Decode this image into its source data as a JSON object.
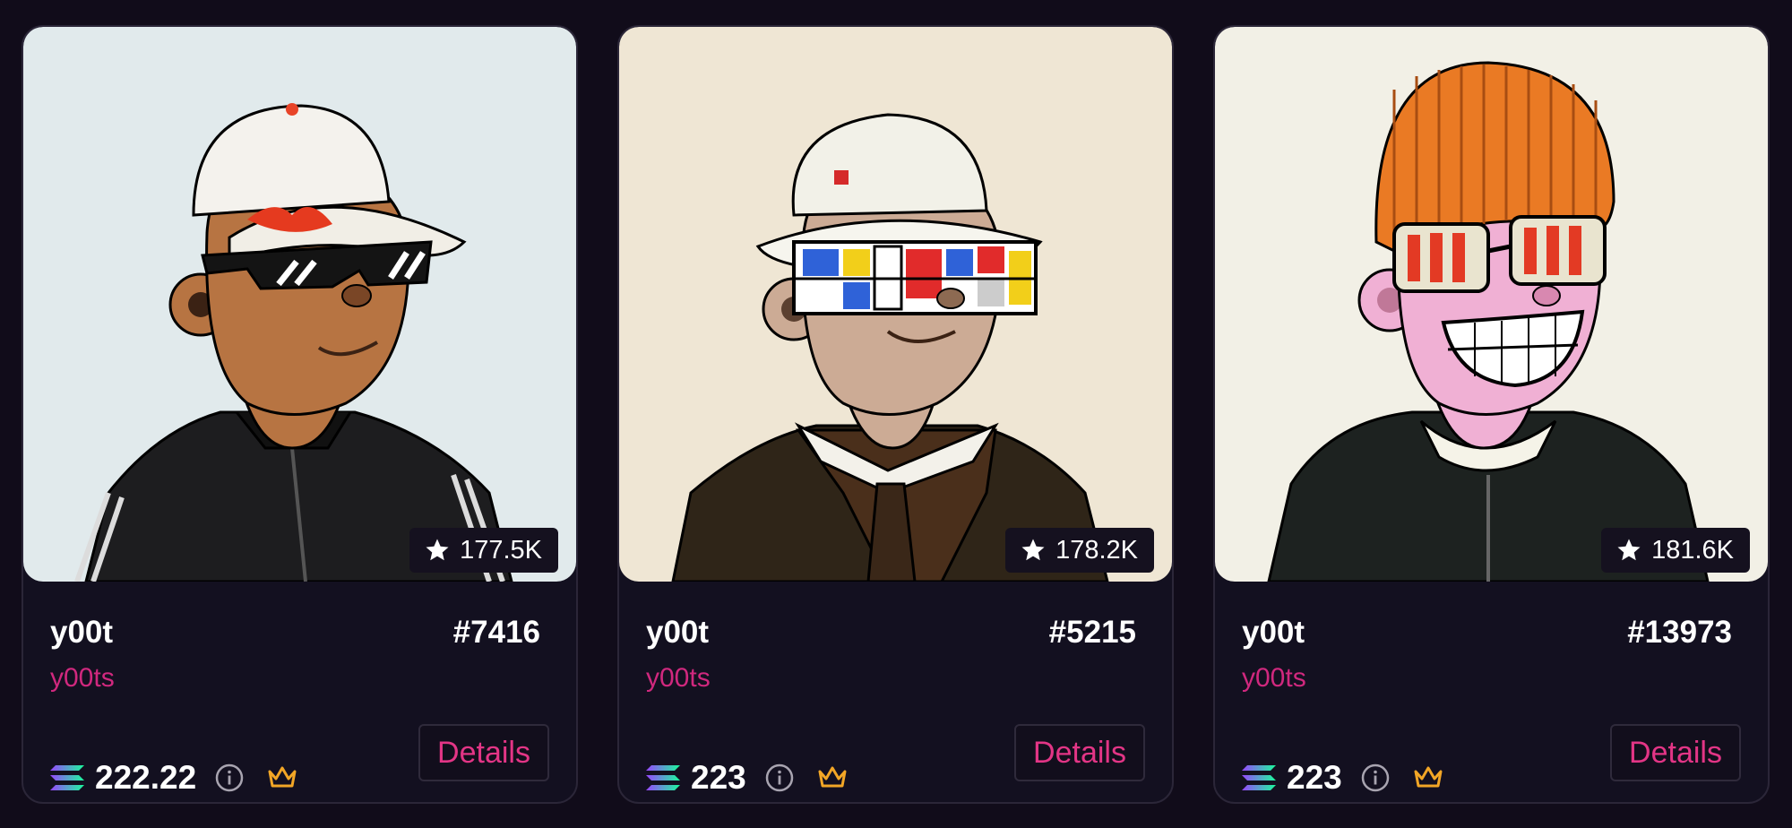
{
  "colors": {
    "page_bg": "#110c1a",
    "card_bg": "#131020",
    "accent_pink": "#d0287e",
    "button_text": "#e33586",
    "crown": "#f2a626",
    "info_icon": "#a8a4b0"
  },
  "cards": [
    {
      "name": "y00t",
      "token_id": "#7416",
      "collection": "y00ts",
      "rank_icon": "star-icon",
      "rank": "177.5K",
      "price_icon": "solana-icon",
      "price": "222.22",
      "details_label": "Details",
      "image": {
        "bg": "#e1eaec",
        "fur": "#b77442",
        "hat": "#f4f2ed",
        "jacket": "#1d1d1f",
        "eyewear": "black shutter shades with red flames"
      }
    },
    {
      "name": "y00t",
      "token_id": "#5215",
      "collection": "y00ts",
      "rank_icon": "star-icon",
      "rank": "178.2K",
      "price_icon": "solana-icon",
      "price": "223",
      "details_label": "Details",
      "image": {
        "bg": "#efe6d4",
        "fur": "#ccab95",
        "hat": "#f2f1e8",
        "jacket": "#2f2518",
        "eyewear": "mondrian pattern visor"
      }
    },
    {
      "name": "y00t",
      "token_id": "#13973",
      "collection": "y00ts",
      "rank_icon": "star-icon",
      "rank": "181.6K",
      "price_icon": "solana-icon",
      "price": "223",
      "details_label": "Details",
      "image": {
        "bg": "#f2f0e6",
        "fur": "#f0b0d4",
        "hat": "#ea7a24",
        "jacket": "#1d2220",
        "eyewear": "striped red glasses"
      }
    }
  ]
}
